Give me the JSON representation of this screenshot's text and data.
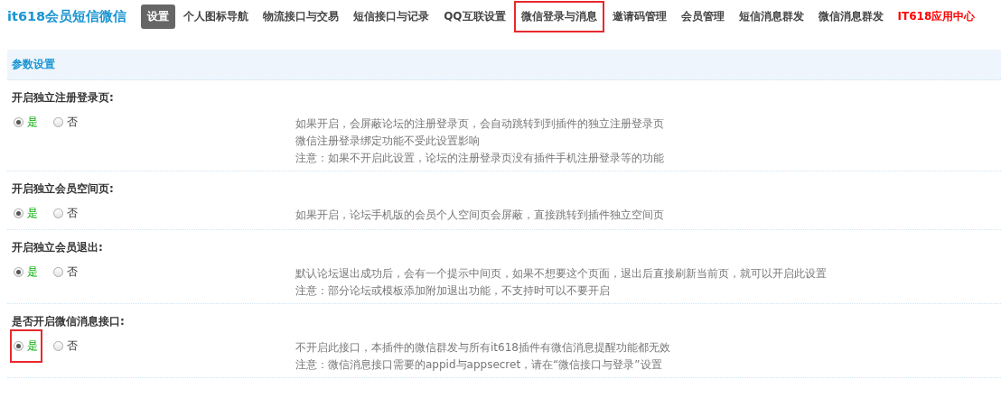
{
  "header": {
    "title": "it618会员短信微信",
    "tabs": [
      {
        "label": "设置",
        "selected": true,
        "highlighted": false,
        "kind": "tab"
      },
      {
        "label": "个人图标导航",
        "selected": false,
        "highlighted": false,
        "kind": "tab"
      },
      {
        "label": "物流接口与交易",
        "selected": false,
        "highlighted": false,
        "kind": "tab"
      },
      {
        "label": "短信接口与记录",
        "selected": false,
        "highlighted": false,
        "kind": "tab"
      },
      {
        "label": "QQ互联设置",
        "selected": false,
        "highlighted": false,
        "kind": "tab"
      },
      {
        "label": "微信登录与消息",
        "selected": false,
        "highlighted": true,
        "kind": "tab"
      },
      {
        "label": "邀请码管理",
        "selected": false,
        "highlighted": false,
        "kind": "tab"
      },
      {
        "label": "会员管理",
        "selected": false,
        "highlighted": false,
        "kind": "tab"
      },
      {
        "label": "短信消息群发",
        "selected": false,
        "highlighted": false,
        "kind": "tab"
      },
      {
        "label": "微信消息群发",
        "selected": false,
        "highlighted": false,
        "kind": "tab"
      },
      {
        "label": "IT618应用中心",
        "selected": false,
        "highlighted": false,
        "kind": "link"
      }
    ]
  },
  "panel": {
    "title": "参数设置",
    "settings": [
      {
        "label": "开启独立注册登录页:",
        "options": [
          {
            "label": "是",
            "selected": true,
            "highlighted": false
          },
          {
            "label": "否",
            "selected": false,
            "highlighted": false
          }
        ],
        "notes": [
          "如果开启，会屏蔽论坛的注册登录页，会自动跳转到到插件的独立注册登录页",
          "微信注册登录绑定功能不受此设置影响",
          "注意：如果不开启此设置，论坛的注册登录页没有插件手机注册登录等的功能"
        ]
      },
      {
        "label": "开启独立会员空间页:",
        "options": [
          {
            "label": "是",
            "selected": true,
            "highlighted": false
          },
          {
            "label": "否",
            "selected": false,
            "highlighted": false
          }
        ],
        "notes": [
          "如果开启，论坛手机版的会员个人空间页会屏蔽，直接跳转到插件独立空间页"
        ]
      },
      {
        "label": "开启独立会员退出:",
        "options": [
          {
            "label": "是",
            "selected": true,
            "highlighted": false
          },
          {
            "label": "否",
            "selected": false,
            "highlighted": false
          }
        ],
        "notes": [
          "默认论坛退出成功后，会有一个提示中间页，如果不想要这个页面，退出后直接刷新当前页，就可以开启此设置",
          "注意：部分论坛或模板添加附加退出功能，不支持时可以不要开启"
        ]
      },
      {
        "label": "是否开启微信消息接口:",
        "options": [
          {
            "label": "是",
            "selected": true,
            "highlighted": true
          },
          {
            "label": "否",
            "selected": false,
            "highlighted": false
          }
        ],
        "notes": [
          "不开启此接口，本插件的微信群发与所有it618插件有微信消息提醒功能都无效",
          "注意：微信消息接口需要的appid与appsecret，请在“微信接口与登录”设置"
        ]
      }
    ]
  }
}
